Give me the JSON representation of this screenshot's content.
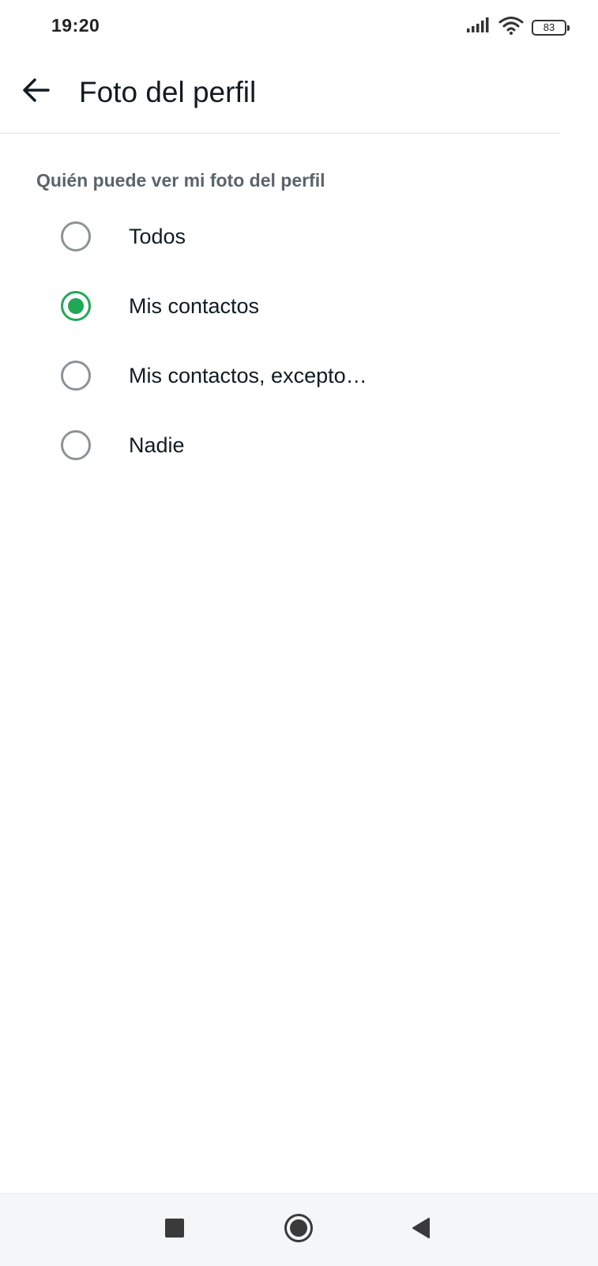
{
  "status_bar": {
    "time": "19:20",
    "battery_level": "83",
    "icons": [
      "signal-icon",
      "wifi-icon",
      "battery-icon"
    ]
  },
  "app_bar": {
    "title": "Foto del perfil",
    "back_icon": "arrow-left-icon"
  },
  "section": {
    "header": "Quién puede ver mi foto del perfil",
    "options": [
      {
        "label": "Todos",
        "selected": false
      },
      {
        "label": "Mis contactos",
        "selected": true
      },
      {
        "label": "Mis contactos, excepto…",
        "selected": false
      },
      {
        "label": "Nadie",
        "selected": false
      }
    ]
  },
  "navigation_bar": {
    "icons": [
      "recents-square-icon",
      "home-circle-icon",
      "back-triangle-icon"
    ]
  },
  "colors": {
    "accent": "#1fa855",
    "radio_unselected": "#8c9296",
    "section_header": "#5a646b",
    "text_primary": "#111b21",
    "nav_bar_background": "#f5f6f7"
  }
}
